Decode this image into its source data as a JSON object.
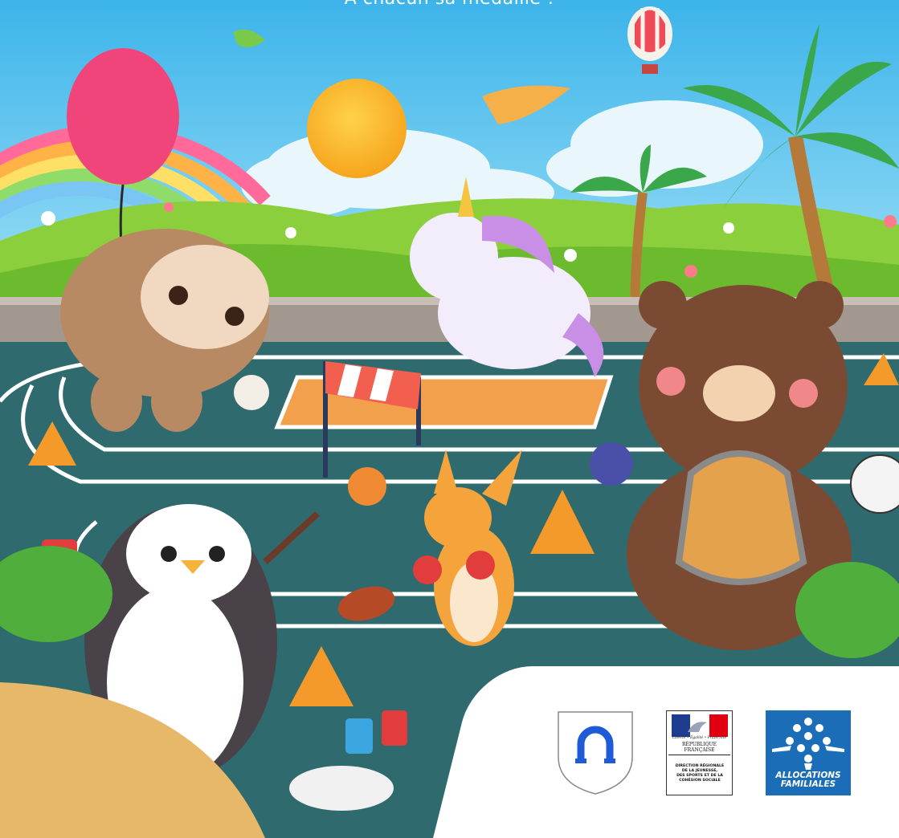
{
  "poster": {
    "tagline": "À chacun sa médaille !"
  },
  "logos": {
    "republique": {
      "motto": "Liberté • Égalité • Fraternité",
      "name": "RÉPUBLIQUE FRANÇAISE",
      "direction": "DIRECTION RÉGIONALE\nDE LA JEUNESSE,\nDES SPORTS ET DE LA\nCOHÉSION SOCIALE"
    },
    "caf": {
      "name": "ALLOCATIONS\nFAMILIALES"
    }
  },
  "colors": {
    "sky": "#5cc3ee",
    "track": "#2f6b6e",
    "grass": "#8ccf3c",
    "caf_blue": "#1a6db6"
  }
}
